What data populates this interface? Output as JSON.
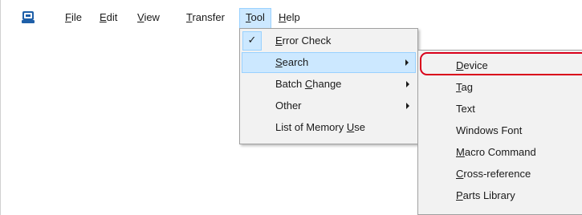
{
  "menubar": {
    "app_icon": "app-monitor-icon",
    "items": [
      {
        "first": "F",
        "rest": "ile"
      },
      {
        "first": "E",
        "rest": "dit"
      },
      {
        "first": "V",
        "rest": "iew"
      },
      {
        "first": "T",
        "rest": "ransfer"
      },
      {
        "first": "T",
        "rest": "ool"
      },
      {
        "first": "H",
        "rest": "elp"
      }
    ]
  },
  "tool_menu": {
    "items": [
      {
        "pre": "",
        "key": "E",
        "post": "rror Check",
        "checked": "✓"
      },
      {
        "pre": "",
        "key": "S",
        "post": "earch"
      },
      {
        "pre": "Batch ",
        "key": "C",
        "post": "hange"
      },
      {
        "pre": "Other",
        "key": "",
        "post": ""
      },
      {
        "pre": "List of Memory ",
        "key": "U",
        "post": "se"
      }
    ]
  },
  "search_submenu": {
    "items": [
      {
        "pre": "",
        "key": "D",
        "post": "evice"
      },
      {
        "pre": "",
        "key": "T",
        "post": "ag"
      },
      {
        "pre": "Text",
        "key": "",
        "post": ""
      },
      {
        "pre": "Windows Font",
        "key": "",
        "post": ""
      },
      {
        "pre": "",
        "key": "M",
        "post": "acro Command"
      },
      {
        "pre": "",
        "key": "C",
        "post": "ross-reference"
      },
      {
        "pre": "",
        "key": "P",
        "post": "arts Library"
      }
    ]
  },
  "colors": {
    "highlight": "#cce8ff",
    "highlight_border": "#99d1ff",
    "menu_bg": "#f2f2f2",
    "callout_red": "#d9001b"
  }
}
